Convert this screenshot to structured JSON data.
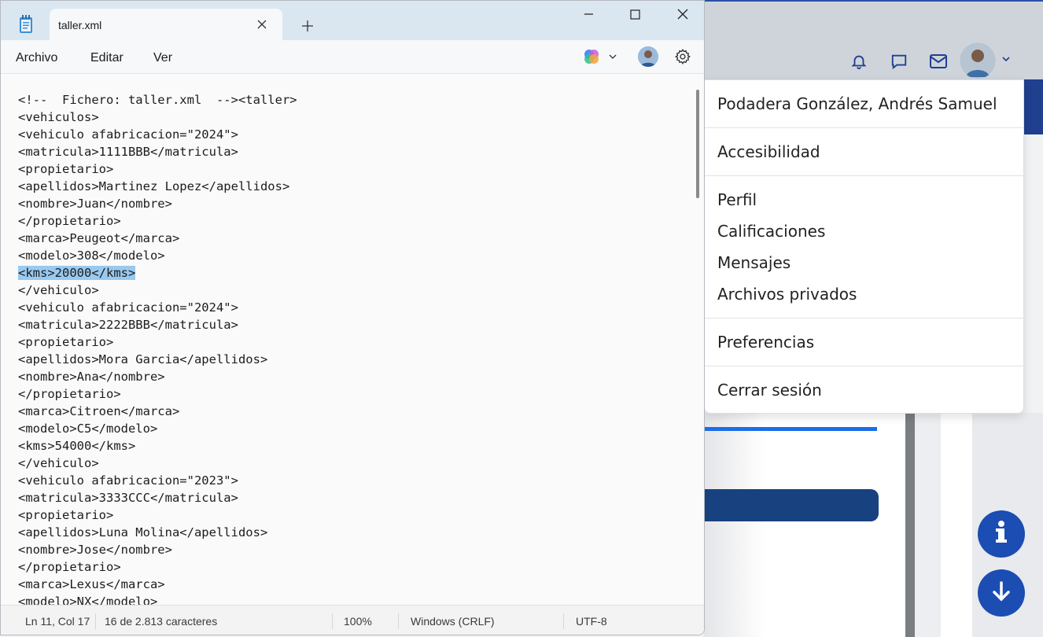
{
  "notepad": {
    "tab_title": "taller.xml",
    "menus": [
      "Archivo",
      "Editar",
      "Ver"
    ],
    "lines": [
      "<!--  Fichero: taller.xml  --><taller>",
      "<vehiculos>",
      "<vehiculo afabricacion=\"2024\">",
      "<matricula>1111BBB</matricula>",
      "<propietario>",
      "<apellidos>Martinez Lopez</apellidos>",
      "<nombre>Juan</nombre>",
      "</propietario>",
      "<marca>Peugeot</marca>",
      "<modelo>308</modelo>",
      "<kms>20000</kms>",
      "</vehiculo>",
      "<vehiculo afabricacion=\"2024\">",
      "<matricula>2222BBB</matricula>",
      "<propietario>",
      "<apellidos>Mora Garcia</apellidos>",
      "<nombre>Ana</nombre>",
      "</propietario>",
      "<marca>Citroen</marca>",
      "<modelo>C5</modelo>",
      "<kms>54000</kms>",
      "</vehiculo>",
      "<vehiculo afabricacion=\"2023\">",
      "<matricula>3333CCC</matricula>",
      "<propietario>",
      "<apellidos>Luna Molina</apellidos>",
      "<nombre>Jose</nombre>",
      "</propietario>",
      "<marca>Lexus</marca>",
      "<modelo>NX</modelo>"
    ],
    "selected_line_number": 11,
    "status": {
      "position": "Ln 11, Col 17",
      "selection": "16 de 2.813 caracteres",
      "zoom": "100%",
      "line_ending": "Windows (CRLF)",
      "encoding": "UTF-8"
    },
    "icons": {
      "app": "notepad-icon",
      "close_tab": "close-icon",
      "new_tab": "plus-icon",
      "minimize": "minimize-icon",
      "maximize": "maximize-icon",
      "close_window": "close-icon",
      "copilot": "copilot-icon",
      "settings": "gear-icon"
    }
  },
  "user_menu": {
    "user_name": "Podadera González, Andrés Samuel",
    "accessibility": "Accesibilidad",
    "items": [
      "Perfil",
      "Calificaciones",
      "Mensajes",
      "Archivos privados"
    ],
    "preferences": "Preferencias",
    "logout": "Cerrar sesión"
  },
  "header_icons": [
    "bell-icon",
    "chat-icon",
    "mail-icon"
  ],
  "fabs": [
    "info-icon",
    "arrow-down-icon"
  ],
  "colors": {
    "selection": "#99c9ef",
    "brand_blue": "#1b4db3",
    "titlebar": "#dbe7f0"
  }
}
